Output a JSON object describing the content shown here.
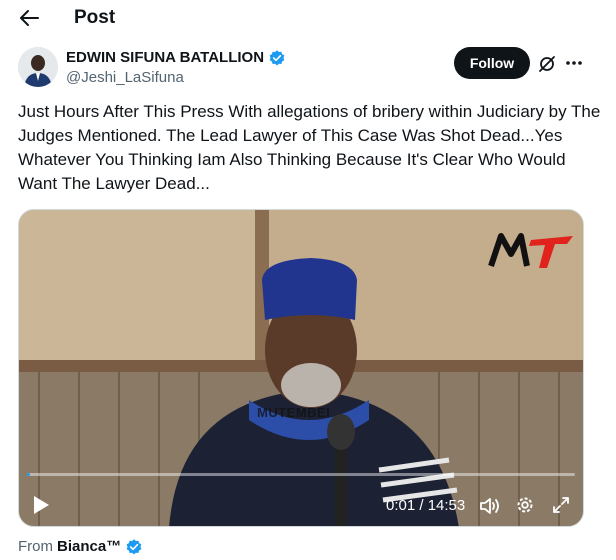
{
  "header": {
    "title": "Post",
    "back_icon": "arrow-left-icon"
  },
  "author": {
    "name": "EDWIN SIFUNA BATALLION",
    "handle": "@Jeshi_LaSifuna",
    "verified": true
  },
  "actions": {
    "follow_label": "Follow"
  },
  "tweet": {
    "text": "Just Hours After This Press With allegations of bribery within Judiciary by The Judges Mentioned. The Lead Lawyer of This Case Was Shot Dead...Yes Whatever You Thinking Iam Also Thinking Because It's Clear Who Would Want The Lawyer Dead..."
  },
  "video": {
    "logo_text": "MT",
    "watermark": "MUTEMBEI",
    "timecode": "0:01 / 14:53",
    "progress": 0.001
  },
  "source": {
    "prefix": "From",
    "name": "Bianca™"
  },
  "colors": {
    "accent": "#1d9bf0",
    "text": "#0f1419",
    "muted": "#536471",
    "logo_red": "#e0231c"
  }
}
